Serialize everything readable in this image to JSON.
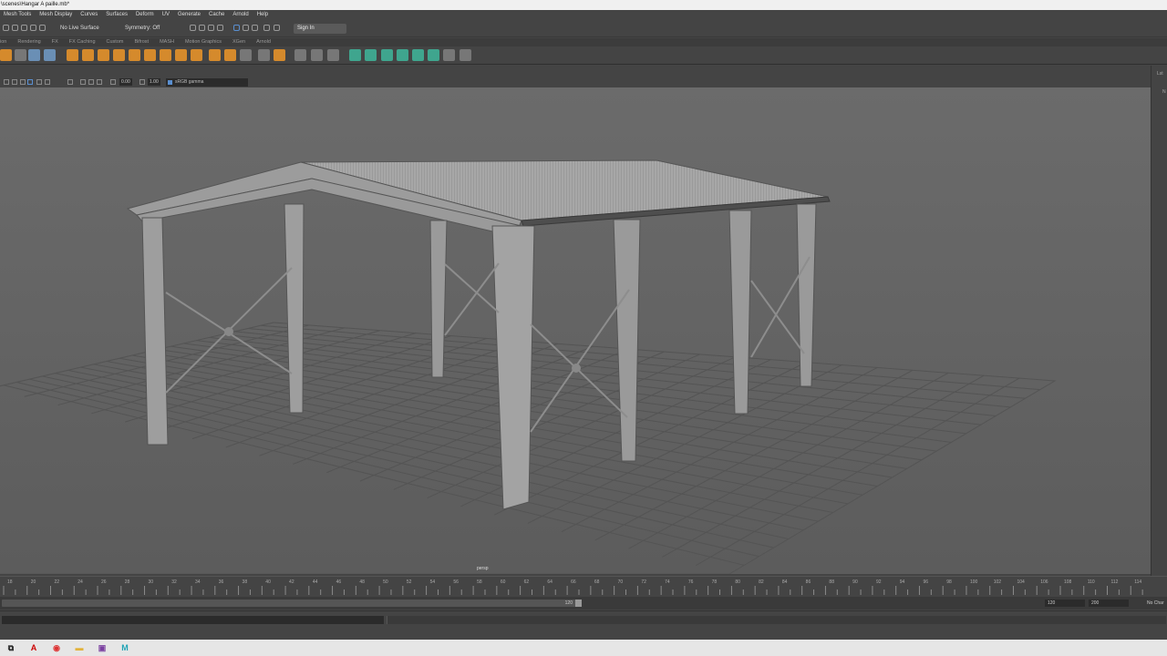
{
  "window": {
    "title": "\\scenes\\Hangar A paille.mb*"
  },
  "menu": [
    "Mesh Tools",
    "Mesh Display",
    "Curves",
    "Surfaces",
    "Deform",
    "UV",
    "Generate",
    "Cache",
    "Arnold",
    "Help"
  ],
  "statusline": {
    "live_surface": "No Live Surface",
    "symmetry": "Symmetry: Off",
    "sign_in": "Sign In"
  },
  "shelf_tabs": [
    "ion",
    "Rendering",
    "FX",
    "FX Caching",
    "Custom",
    "Bifrost",
    "MASH",
    "Motion Graphics",
    "XGen",
    "Arnold"
  ],
  "viewport": {
    "near_value": "0.00",
    "far_value": "1.00",
    "color_space": "sRGB gamma",
    "camera_label": "persp",
    "colors": {
      "background": "#6a6a6a",
      "grid": "#555555",
      "model": "#9a9a9a"
    }
  },
  "timeline": {
    "ticks": [
      "18",
      "20",
      "22",
      "24",
      "26",
      "28",
      "30",
      "32",
      "34",
      "36",
      "38",
      "40",
      "42",
      "44",
      "46",
      "48",
      "50",
      "52",
      "54",
      "56",
      "58",
      "60",
      "62",
      "64",
      "66",
      "68",
      "70",
      "72",
      "74",
      "76",
      "78",
      "80",
      "82",
      "84",
      "86",
      "88",
      "90",
      "92",
      "94",
      "96",
      "98",
      "100",
      "102",
      "104",
      "106",
      "108",
      "110",
      "112",
      "114"
    ]
  },
  "range": {
    "slider_end": "120",
    "end_field": "120",
    "max_field": "200",
    "char_set": "No Char"
  },
  "right_panel": {
    "label_top": "Lst",
    "label_mid": "N"
  }
}
